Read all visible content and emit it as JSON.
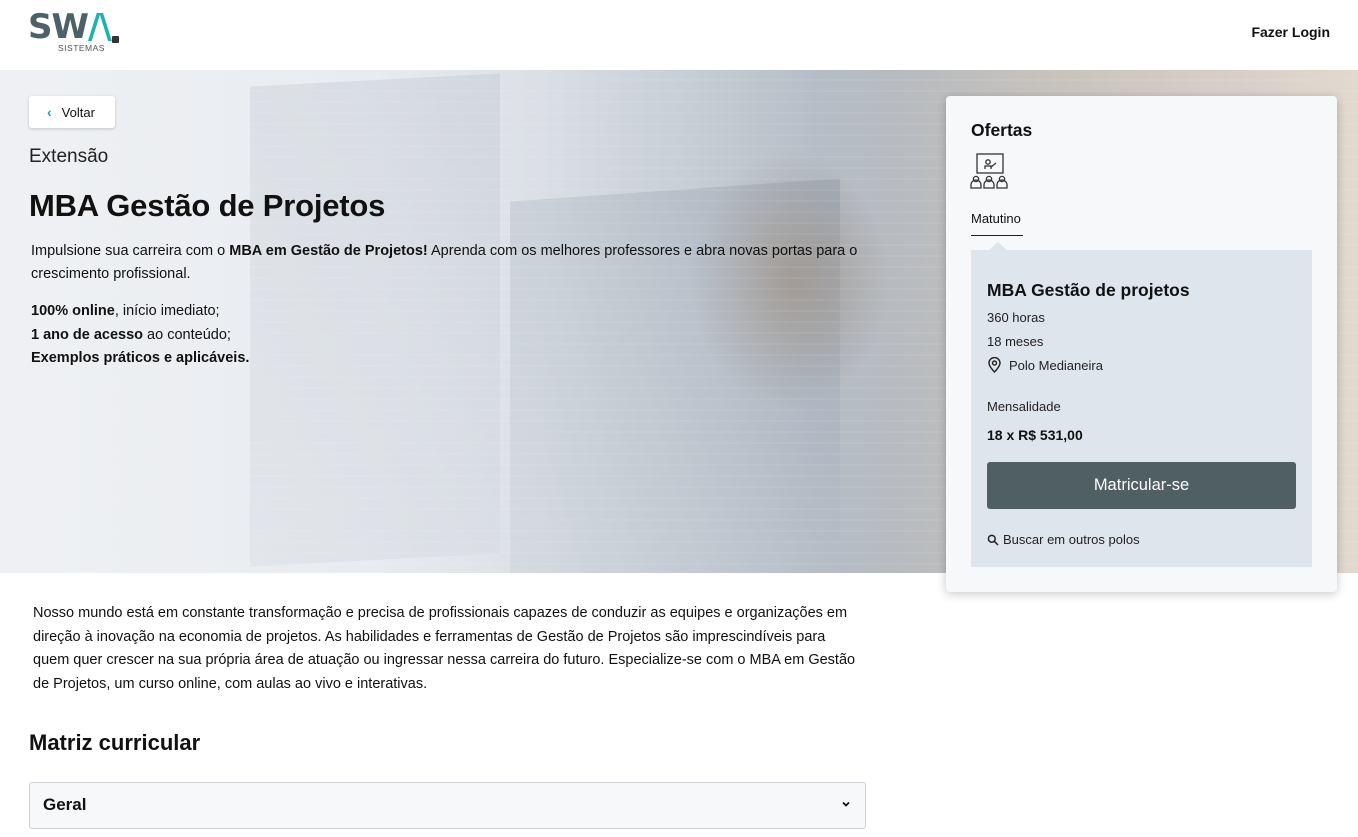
{
  "header": {
    "logo_text_main": "SW",
    "logo_text_accent": "/\\",
    "logo_sub": "SISTEMAS",
    "login_label": "Fazer Login"
  },
  "hero": {
    "back_label": "Voltar",
    "category": "Extensão",
    "title": "MBA Gestão de Projetos",
    "intro_pre": "Impulsione sua carreira com o ",
    "intro_bold": "MBA em Gestão de Projetos!",
    "intro_post": " Aprenda com os melhores professores e abra novas portas para o crescimento profissional.",
    "features": [
      {
        "bold": "100% online",
        "text": ", início imediato;"
      },
      {
        "bold": "1 ano de acesso",
        "text": " ao conteúdo;"
      },
      {
        "bold": "Exemplos práticos e aplicáveis.",
        "text": ""
      }
    ]
  },
  "offers": {
    "title": "Ofertas",
    "icon": "classroom-icon",
    "shift_tab": "Matutino",
    "offer": {
      "name": "MBA Gestão de projetos",
      "hours": "360 horas",
      "months": "18 meses",
      "polo": "Polo Medianeira",
      "monthly_label": "Mensalidade",
      "price": "18 x R$ 531,00",
      "enroll_label": "Matricular-se",
      "search_label": "Buscar em outros polos"
    }
  },
  "content": {
    "description": "Nosso mundo está em constante transformação e precisa de profissionais capazes de conduzir as equipes e organizações em direção à inovação na economia de projetos. As habilidades e ferramentas de Gestão de Projetos são imprescindíveis para quem quer crescer na sua própria área de atuação ou ingressar nessa carreira do futuro. Especialize-se com o MBA em Gestão de Projetos, um curso online, com aulas ao vivo e interativas.",
    "curriculum_title": "Matriz curricular",
    "accordion_label": "Geral"
  },
  "colors": {
    "accent": "#1ab3ae",
    "logo": "#4c6268",
    "button": "#4f5f62",
    "offer_box": "#dfe5ec"
  }
}
